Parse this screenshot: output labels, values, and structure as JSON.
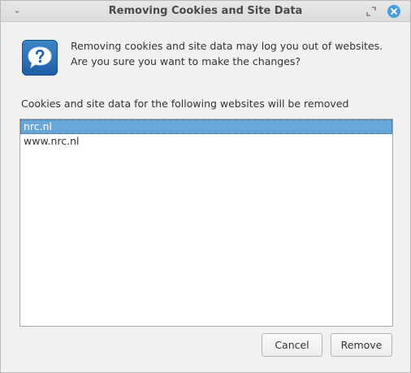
{
  "window": {
    "title": "Removing Cookies and Site Data",
    "accent_color": "#4a9ed9"
  },
  "icons": {
    "window_menu": "chevron-down-icon",
    "restore": "restore-icon",
    "close": "close-icon",
    "question": "question-icon"
  },
  "message": "Removing cookies and site data may log you out of websites. Are you sure you want to make the changes?",
  "list": {
    "label": "Cookies and site data for the following websites will be removed",
    "items": [
      {
        "label": "nrc.nl",
        "selected": true
      },
      {
        "label": "www.nrc.nl",
        "selected": false
      }
    ]
  },
  "buttons": {
    "cancel": "Cancel",
    "remove": "Remove"
  }
}
